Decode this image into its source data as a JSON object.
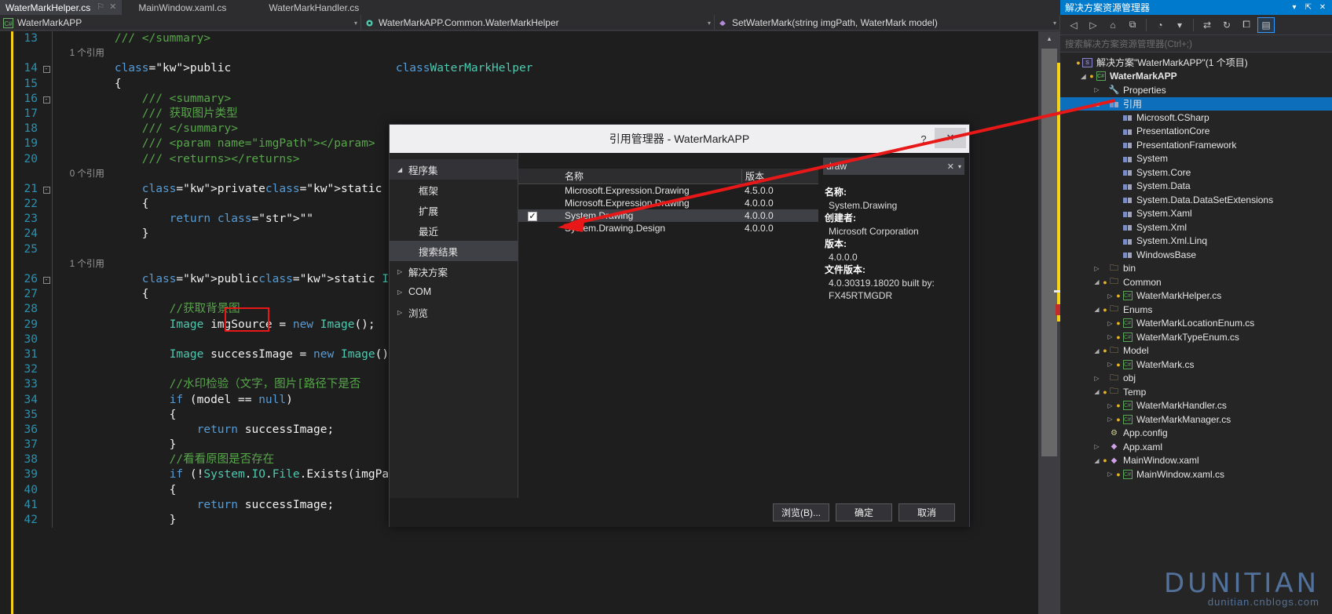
{
  "editor": {
    "tabs": [
      {
        "label": "WaterMarkHelper.cs",
        "active": true,
        "pin": "⚐",
        "close": "✕"
      },
      {
        "label": "MainWindow.xaml.cs",
        "active": false
      },
      {
        "label": "WaterMarkHandler.cs",
        "active": false
      }
    ],
    "navbar": {
      "project": "WaterMarkAPP",
      "type": "WaterMarkAPP.Common.WaterMarkHelper",
      "member": "SetWaterMark(string imgPath, WaterMark model)",
      "arrow": "▾"
    },
    "lines": [
      {
        "n": "13",
        "fold": "",
        "ref": "",
        "code": "        /// </summary>"
      },
      {
        "n": "14",
        "fold": "-",
        "ref": "1 个引用",
        "code": "        public class WaterMarkHelper"
      },
      {
        "n": "15",
        "fold": "",
        "ref": "",
        "code": "        {"
      },
      {
        "n": "16",
        "fold": "-",
        "ref": "",
        "code": "            /// <summary>"
      },
      {
        "n": "17",
        "fold": "",
        "ref": "",
        "code": "            /// 获取图片类型"
      },
      {
        "n": "18",
        "fold": "",
        "ref": "",
        "code": "            /// </summary>"
      },
      {
        "n": "19",
        "fold": "",
        "ref": "",
        "code": "            /// <param name=\"imgPath\"></param>"
      },
      {
        "n": "20",
        "fold": "",
        "ref": "",
        "code": "            /// <returns></returns>"
      },
      {
        "n": "21",
        "fold": "-",
        "ref": "0 个引用",
        "code": "            private static string GetPhotoType(s"
      },
      {
        "n": "22",
        "fold": "",
        "ref": "",
        "code": "            {"
      },
      {
        "n": "23",
        "fold": "",
        "ref": "",
        "code": "                return \"\";"
      },
      {
        "n": "24",
        "fold": "",
        "ref": "",
        "code": "            }"
      },
      {
        "n": "25",
        "fold": "",
        "ref": "",
        "code": ""
      },
      {
        "n": "26",
        "fold": "-",
        "ref": "1 个引用",
        "code": "            public static Image SetWaterMark(str"
      },
      {
        "n": "27",
        "fold": "",
        "ref": "",
        "code": "            {"
      },
      {
        "n": "28",
        "fold": "",
        "ref": "",
        "code": "                //获取背景图"
      },
      {
        "n": "29",
        "fold": "",
        "ref": "",
        "code": "                Image imgSource = new Image();"
      },
      {
        "n": "30",
        "fold": "",
        "ref": "",
        "code": ""
      },
      {
        "n": "31",
        "fold": "",
        "ref": "",
        "code": "                Image successImage = new Image()"
      },
      {
        "n": "32",
        "fold": "",
        "ref": "",
        "code": ""
      },
      {
        "n": "33",
        "fold": "",
        "ref": "",
        "code": "                //水印检验（文字，图片[路径下是否"
      },
      {
        "n": "34",
        "fold": "",
        "ref": "",
        "code": "                if (model == null)"
      },
      {
        "n": "35",
        "fold": "",
        "ref": "",
        "code": "                {"
      },
      {
        "n": "36",
        "fold": "",
        "ref": "",
        "code": "                    return successImage;"
      },
      {
        "n": "37",
        "fold": "",
        "ref": "",
        "code": "                }"
      },
      {
        "n": "38",
        "fold": "",
        "ref": "",
        "code": "                //看看原图是否存在"
      },
      {
        "n": "39",
        "fold": "",
        "ref": "",
        "code": "                if (!System.IO.File.Exists(imgPa"
      },
      {
        "n": "40",
        "fold": "",
        "ref": "",
        "code": "                {"
      },
      {
        "n": "41",
        "fold": "",
        "ref": "",
        "code": "                    return successImage;"
      },
      {
        "n": "42",
        "fold": "",
        "ref": "",
        "code": "                }"
      }
    ]
  },
  "dialog": {
    "title": "引用管理器 - WaterMarkAPP",
    "help_icon": "?",
    "close_icon": "✕",
    "nav": [
      {
        "label": "程序集",
        "type": "group",
        "caret": "◢"
      },
      {
        "label": "框架",
        "type": "child"
      },
      {
        "label": "扩展",
        "type": "child"
      },
      {
        "label": "最近",
        "type": "child"
      },
      {
        "label": "搜索结果",
        "type": "child",
        "selected": true
      },
      {
        "label": "解决方案",
        "type": "group-collapsed",
        "caret": "▷"
      },
      {
        "label": "COM",
        "type": "group-collapsed",
        "caret": "▷"
      },
      {
        "label": "浏览",
        "type": "group-collapsed",
        "caret": "▷"
      }
    ],
    "columns": {
      "name": "名称",
      "version": "版本"
    },
    "rows": [
      {
        "checked": false,
        "name": "Microsoft.Expression.Drawing",
        "version": "4.5.0.0",
        "selected": false
      },
      {
        "checked": false,
        "name": "Microsoft.Expression.Drawing",
        "version": "4.0.0.0",
        "selected": false
      },
      {
        "checked": true,
        "name": "System.Drawing",
        "version": "4.0.0.0",
        "selected": true
      },
      {
        "checked": false,
        "name": "System.Drawing.Design",
        "version": "4.0.0.0",
        "selected": false
      }
    ],
    "search": {
      "value": "draw",
      "clear_icon": "✕",
      "caret_icon": "▾"
    },
    "info": [
      {
        "key": "名称:",
        "value": "System.Drawing"
      },
      {
        "key": "创建者:",
        "value": "Microsoft Corporation"
      },
      {
        "key": "版本:",
        "value": "4.0.0.0"
      },
      {
        "key": "文件版本:",
        "value": "4.0.30319.18020 built by: FX45RTMGDR"
      }
    ],
    "buttons": {
      "browse": "浏览(B)...",
      "ok": "确定",
      "cancel": "取消"
    }
  },
  "solution_explorer": {
    "title": "解决方案资源管理器",
    "title_tools": [
      "▾",
      "⇱",
      "✕"
    ],
    "toolbar": [
      {
        "icon": "◁",
        "name": "back-icon"
      },
      {
        "icon": "▷",
        "name": "forward-icon"
      },
      {
        "icon": "⌂",
        "name": "home-icon"
      },
      {
        "icon": "⧉",
        "name": "sync-with-active-document-icon"
      },
      {
        "icon": "◔",
        "name": "show-all-files-icon"
      },
      {
        "icon": "▾",
        "name": "show-all-files-dropdown-icon"
      },
      {
        "icon": "⇄",
        "name": "refresh-icon"
      },
      {
        "icon": "↻",
        "name": "collapse-all-icon"
      },
      {
        "icon": "⧠",
        "name": "properties-icon"
      },
      {
        "icon": "▤",
        "name": "preview-selected-items-icon",
        "selected": true
      }
    ],
    "search_placeholder": "搜索解决方案资源管理器(Ctrl+;)",
    "tree": [
      {
        "label": "解决方案\"WaterMarkAPP\"(1 个项目)",
        "indent": 0,
        "icon": "sln",
        "expander": "",
        "dot": true
      },
      {
        "label": "WaterMarkAPP",
        "indent": 1,
        "icon": "cs",
        "expander": "◢",
        "dot": true,
        "bold": true
      },
      {
        "label": "Properties",
        "indent": 2,
        "icon": "wrench",
        "expander": "▷"
      },
      {
        "label": "引用",
        "indent": 2,
        "icon": "ref",
        "expander": "◢",
        "selected": true
      },
      {
        "label": "Microsoft.CSharp",
        "indent": 3,
        "icon": "ref",
        "expander": ""
      },
      {
        "label": "PresentationCore",
        "indent": 3,
        "icon": "ref",
        "expander": ""
      },
      {
        "label": "PresentationFramework",
        "indent": 3,
        "icon": "ref",
        "expander": ""
      },
      {
        "label": "System",
        "indent": 3,
        "icon": "ref",
        "expander": ""
      },
      {
        "label": "System.Core",
        "indent": 3,
        "icon": "ref",
        "expander": ""
      },
      {
        "label": "System.Data",
        "indent": 3,
        "icon": "ref",
        "expander": ""
      },
      {
        "label": "System.Data.DataSetExtensions",
        "indent": 3,
        "icon": "ref",
        "expander": ""
      },
      {
        "label": "System.Xaml",
        "indent": 3,
        "icon": "ref",
        "expander": ""
      },
      {
        "label": "System.Xml",
        "indent": 3,
        "icon": "ref",
        "expander": ""
      },
      {
        "label": "System.Xml.Linq",
        "indent": 3,
        "icon": "ref",
        "expander": ""
      },
      {
        "label": "WindowsBase",
        "indent": 3,
        "icon": "ref",
        "expander": ""
      },
      {
        "label": "bin",
        "indent": 2,
        "icon": "folder",
        "expander": "▷"
      },
      {
        "label": "Common",
        "indent": 2,
        "icon": "folder",
        "expander": "◢",
        "dot": true
      },
      {
        "label": "WaterMarkHelper.cs",
        "indent": 3,
        "icon": "cs",
        "expander": "▷",
        "dot": true
      },
      {
        "label": "Enums",
        "indent": 2,
        "icon": "folder",
        "expander": "◢",
        "dot": true
      },
      {
        "label": "WaterMarkLocationEnum.cs",
        "indent": 3,
        "icon": "cs",
        "expander": "▷",
        "dot": true
      },
      {
        "label": "WaterMarkTypeEnum.cs",
        "indent": 3,
        "icon": "cs",
        "expander": "▷",
        "dot": true
      },
      {
        "label": "Model",
        "indent": 2,
        "icon": "folder",
        "expander": "◢",
        "dot": true
      },
      {
        "label": "WaterMark.cs",
        "indent": 3,
        "icon": "cs",
        "expander": "▷",
        "dot": true
      },
      {
        "label": "obj",
        "indent": 2,
        "icon": "folder",
        "expander": "▷"
      },
      {
        "label": "Temp",
        "indent": 2,
        "icon": "folder",
        "expander": "◢",
        "dot": true
      },
      {
        "label": "WaterMarkHandler.cs",
        "indent": 3,
        "icon": "cs",
        "expander": "▷",
        "dot": true
      },
      {
        "label": "WaterMarkManager.cs",
        "indent": 3,
        "icon": "cs",
        "expander": "▷",
        "dot": true
      },
      {
        "label": "App.config",
        "indent": 2,
        "icon": "cfg",
        "expander": ""
      },
      {
        "label": "App.xaml",
        "indent": 2,
        "icon": "xaml",
        "expander": "▷"
      },
      {
        "label": "MainWindow.xaml",
        "indent": 2,
        "icon": "xaml",
        "expander": "◢",
        "dot": true
      },
      {
        "label": "MainWindow.xaml.cs",
        "indent": 3,
        "icon": "cs",
        "expander": "▷",
        "dot": true
      }
    ]
  },
  "watermark": {
    "line1": "DUNITIAN",
    "line2": "dunitian.cnblogs.com"
  },
  "colors": {
    "accent": "#007acc",
    "selection": "#0d6ebc",
    "annotation": "#e81818",
    "editor_bg": "#1e1e1e",
    "chrome_bg": "#2d2d30"
  }
}
